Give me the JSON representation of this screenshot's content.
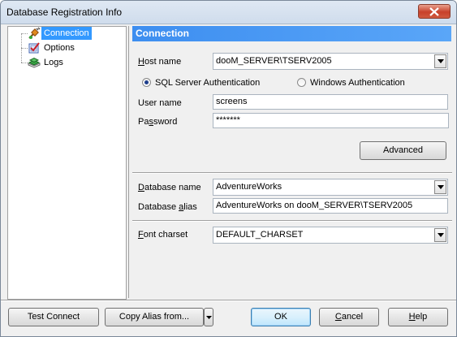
{
  "window": {
    "title": "Database Registration Info"
  },
  "tree": {
    "items": [
      {
        "label": "Connection",
        "icon": "connection-plug-icon"
      },
      {
        "label": "Options",
        "icon": "options-check-icon"
      },
      {
        "label": "Logs",
        "icon": "logs-book-icon"
      }
    ]
  },
  "header": {
    "title": "Connection"
  },
  "form": {
    "host_name": {
      "label_pre": "",
      "label_ul": "H",
      "label_post": "ost name",
      "value": "dooM_SERVER\\TSERV2005"
    },
    "auth": {
      "sql": {
        "label": "SQL Server Authentication",
        "selected": true
      },
      "windows": {
        "label": "Windows Authentication",
        "selected": false
      }
    },
    "user_name": {
      "label": "User name",
      "value": "screens"
    },
    "password": {
      "label_pre": "Pa",
      "label_ul": "s",
      "label_post": "sword",
      "value": "*******"
    },
    "advanced_label": "Advanced",
    "database_name": {
      "label_pre": "",
      "label_ul": "D",
      "label_post": "atabase name",
      "value": "AdventureWorks"
    },
    "database_alias": {
      "label_pre": "Database ",
      "label_ul": "a",
      "label_post": "lias",
      "value": "AdventureWorks on dooM_SERVER\\TSERV2005"
    },
    "font_charset": {
      "label_pre": "",
      "label_ul": "F",
      "label_post": "ont charset",
      "value": "DEFAULT_CHARSET"
    }
  },
  "buttons": {
    "test_connect": "Test Connect",
    "copy_alias": "Copy Alias from...",
    "ok": "OK",
    "cancel_pre": "",
    "cancel_ul": "C",
    "cancel_post": "ancel",
    "help_pre": "",
    "help_ul": "H",
    "help_post": "elp"
  },
  "colors": {
    "header_bg": "#3d8ef0",
    "selection": "#3399ff",
    "close_button": "#c8412a"
  }
}
